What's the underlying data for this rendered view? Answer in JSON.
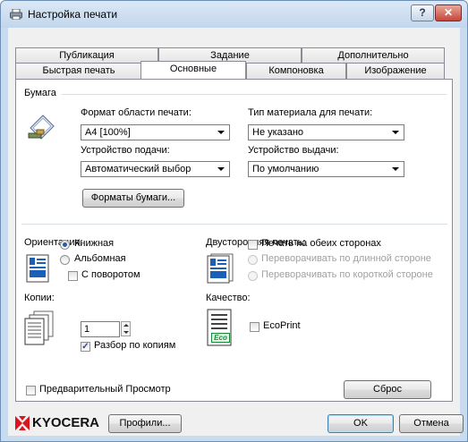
{
  "window": {
    "title": "Настройка печати",
    "help_label": "?",
    "close_label": "✕"
  },
  "tabs": {
    "row_top": [
      "Публикация",
      "Задание",
      "Дополнительно"
    ],
    "row_bottom": [
      "Быстрая печать",
      "Основные",
      "Компоновка",
      "Изображение"
    ],
    "active": "Основные"
  },
  "paper": {
    "group_label": "Бумага",
    "page_size_label": "Формат области печати:",
    "page_size_value": "A4  [100%]",
    "media_type_label": "Тип материала для печати:",
    "media_type_value": "Не указано",
    "source_label": "Устройство подачи:",
    "source_value": "Автоматический выбор",
    "destination_label": "Устройство выдачи:",
    "destination_value": "По умолчанию",
    "paper_sizes_button": "Форматы бумаги..."
  },
  "orientation": {
    "label": "Ориентация:",
    "portrait": "Книжная",
    "landscape": "Альбомная",
    "rotated": "С поворотом",
    "selected": "portrait"
  },
  "duplex": {
    "label": "Двусторонняя печать:",
    "both_sides": "Печать на обеих сторонах",
    "long_edge": "Переворачивать по длинной стороне",
    "short_edge": "Переворачивать по короткой стороне"
  },
  "copies": {
    "label": "Копии:",
    "value": "1",
    "collate_label": "Разбор по копиям",
    "collate_checked": true
  },
  "quality": {
    "label": "Качество:",
    "ecoprint_label": "EcoPrint",
    "eco_icon_text": "Eco"
  },
  "preview": {
    "label": "Предварительный Просмотр",
    "checked": false
  },
  "reset_button": "Сброс",
  "footer": {
    "brand": "KYOCERA",
    "profiles_button": "Профили...",
    "ok_button": "OK",
    "cancel_button": "Отмена"
  },
  "colors": {
    "titlebar": "#c2d6ec",
    "brand_red": "#d7161e",
    "eco_green": "#1a8a3a",
    "window_border": "#6e8fb5"
  },
  "icons": [
    "printer-icon",
    "paper-icon",
    "portrait-icon",
    "duplex-icon",
    "copies-icon",
    "ecoprint-icon",
    "kyocera-logo-icon"
  ]
}
